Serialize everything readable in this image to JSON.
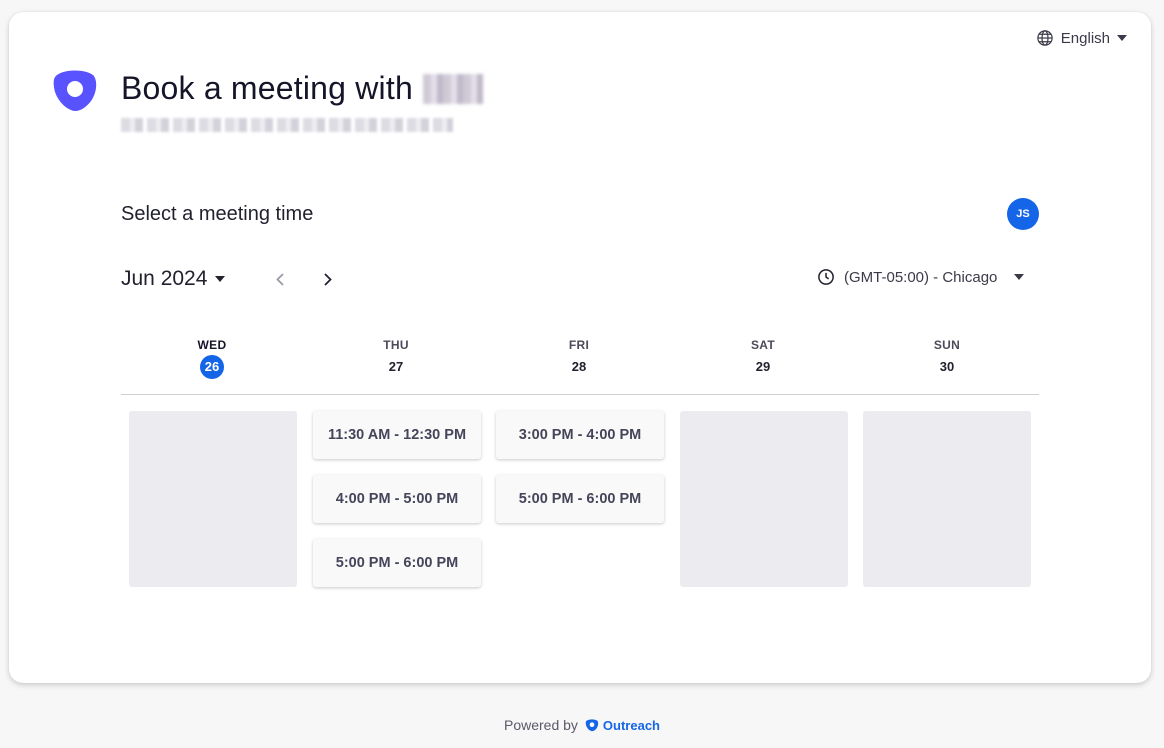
{
  "header": {
    "language": "English",
    "title": "Book a meeting with"
  },
  "section": {
    "heading": "Select a meeting time",
    "host_initials": "JS"
  },
  "calendar": {
    "month_label": "Jun 2024",
    "timezone": "(GMT-05:00) - Chicago",
    "days": [
      {
        "name": "WED",
        "num": "26"
      },
      {
        "name": "THU",
        "num": "27"
      },
      {
        "name": "FRI",
        "num": "28"
      },
      {
        "name": "SAT",
        "num": "29"
      },
      {
        "name": "SUN",
        "num": "30"
      }
    ],
    "slots": {
      "thu": [
        "11:30 AM - 12:30 PM",
        "4:00 PM - 5:00 PM",
        "5:00 PM - 6:00 PM"
      ],
      "fri": [
        "3:00 PM - 4:00 PM",
        "5:00 PM - 6:00 PM"
      ]
    }
  },
  "footer": {
    "powered_by": "Powered by",
    "brand": "Outreach"
  },
  "colors": {
    "accent": "#1565e8",
    "logo": "#5952ff"
  }
}
